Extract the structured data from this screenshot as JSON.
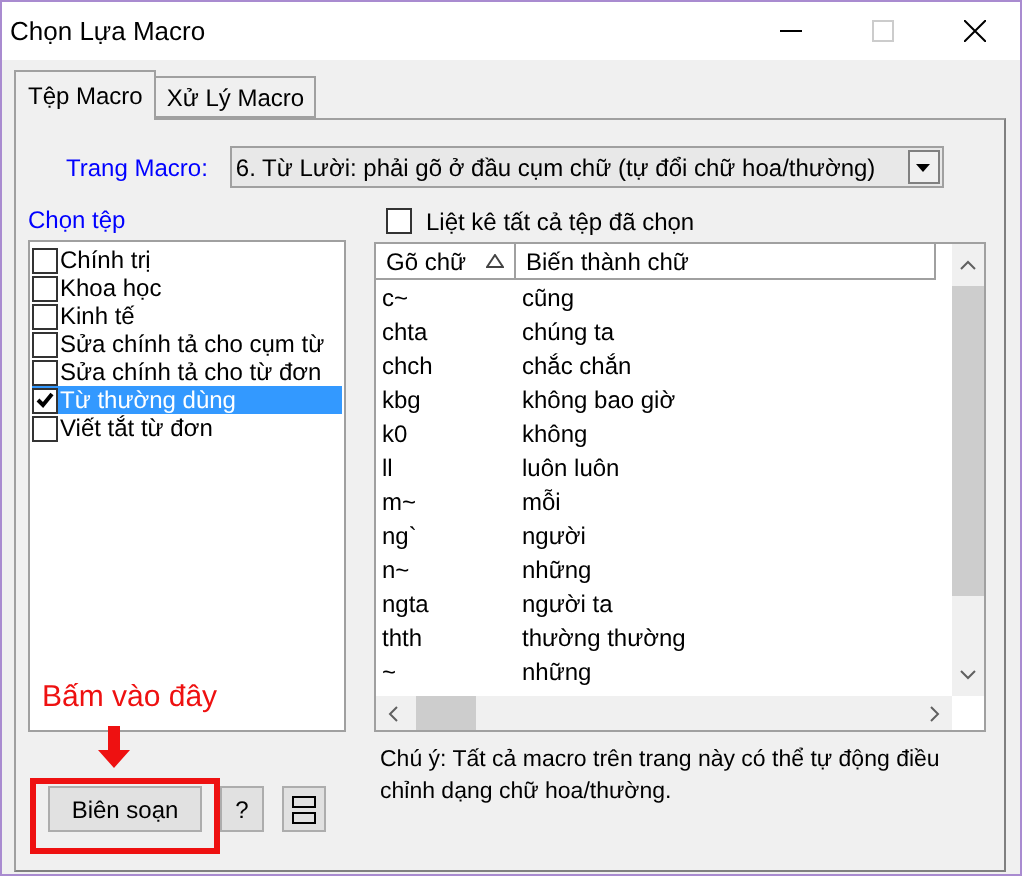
{
  "window": {
    "title": "Chọn Lựa Macro"
  },
  "tabs": [
    {
      "label": "Tệp Macro",
      "selected": true
    },
    {
      "label": "Xử Lý Macro",
      "selected": false
    }
  ],
  "macro_page": {
    "label": "Trang Macro:",
    "value": "6. Từ Lười: phải gõ ở đầu cụm chữ (tự đổi chữ hoa/thường)"
  },
  "file_list": {
    "label": "Chọn tệp",
    "items": [
      {
        "label": "Chính trị",
        "checked": false,
        "selected": false
      },
      {
        "label": "Khoa học",
        "checked": false,
        "selected": false
      },
      {
        "label": "Kinh tế",
        "checked": false,
        "selected": false
      },
      {
        "label": "Sửa chính tả cho cụm từ",
        "checked": false,
        "selected": false
      },
      {
        "label": "Sửa chính tả cho từ đơn",
        "checked": false,
        "selected": false
      },
      {
        "label": "Từ thường dùng",
        "checked": true,
        "selected": true
      },
      {
        "label": "Viết tắt từ đơn",
        "checked": false,
        "selected": false
      }
    ]
  },
  "list_all": {
    "label": "Liệt kê tất cả tệp đã chọn",
    "checked": false
  },
  "table": {
    "columns": [
      "Gõ chữ",
      "Biến thành chữ"
    ],
    "rows": [
      [
        "c~",
        "cũng"
      ],
      [
        "chta",
        "chúng ta"
      ],
      [
        "chch",
        "chắc chắn"
      ],
      [
        "kbg",
        "không bao giờ"
      ],
      [
        "k0",
        "không"
      ],
      [
        "ll",
        "luôn luôn"
      ],
      [
        "m~",
        "mỗi"
      ],
      [
        "ng`",
        "người"
      ],
      [
        "n~",
        "những"
      ],
      [
        "ngta",
        "người ta"
      ],
      [
        "thth",
        "thường thường"
      ],
      [
        "~",
        "những"
      ]
    ]
  },
  "note": "Chú ý: Tất cả macro trên trang này có thể tự động điều chỉnh dạng chữ hoa/thường.",
  "annotation": {
    "text": "Bấm vào đây"
  },
  "buttons": [
    {
      "kind": "text",
      "label": "Biên soạn"
    },
    {
      "kind": "text",
      "label": "?"
    },
    {
      "kind": "icon"
    }
  ]
}
